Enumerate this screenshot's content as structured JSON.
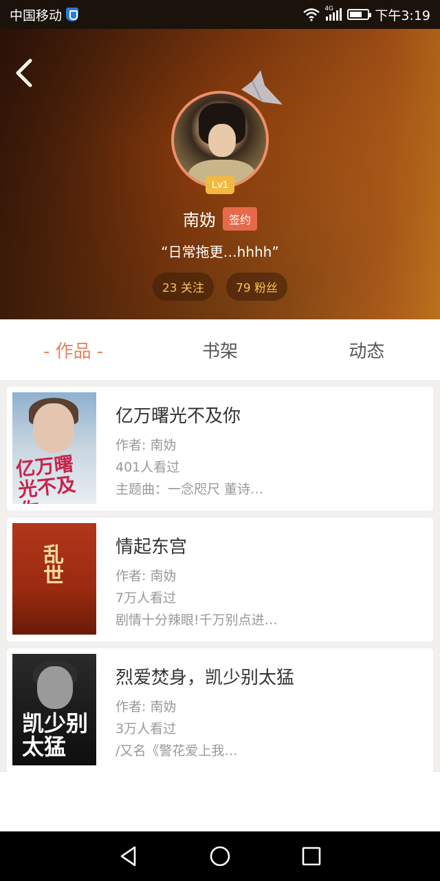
{
  "status_bar": {
    "carrier": "中国移动",
    "network": "4G",
    "time": "下午3:19"
  },
  "profile": {
    "level": "Lv1",
    "name": "南妫",
    "sign_badge": "签约",
    "motto": "“日常拖更…hhhh”",
    "following": "23 关注",
    "fans": "79 粉丝"
  },
  "tabs": [
    {
      "label": "- 作品 -",
      "active": true
    },
    {
      "label": "书架",
      "active": false
    },
    {
      "label": "动态",
      "active": false
    }
  ],
  "books": [
    {
      "title": "亿万曙光不及你",
      "author": "作者: 南妫",
      "views": "401人看过",
      "desc": "主题曲：一念咫尺 董诗…",
      "cover_text": "亿万曙光不及你"
    },
    {
      "title": "情起东宫",
      "author": "作者: 南妫",
      "views": "7万人看过",
      "desc": "剧情十分辣眼!千万别点进…",
      "cover_text": "乱世"
    },
    {
      "title": "烈爱焚身，凯少别太猛",
      "author": "作者: 南妫",
      "views": "3万人看过",
      "desc": "/又名《警花爱上我…",
      "cover_text": "凯少别太猛"
    }
  ],
  "colors": {
    "accent": "#e8825c",
    "badge": "#e66a49",
    "level": "#f3b93f",
    "stat_text": "#f4c451"
  }
}
